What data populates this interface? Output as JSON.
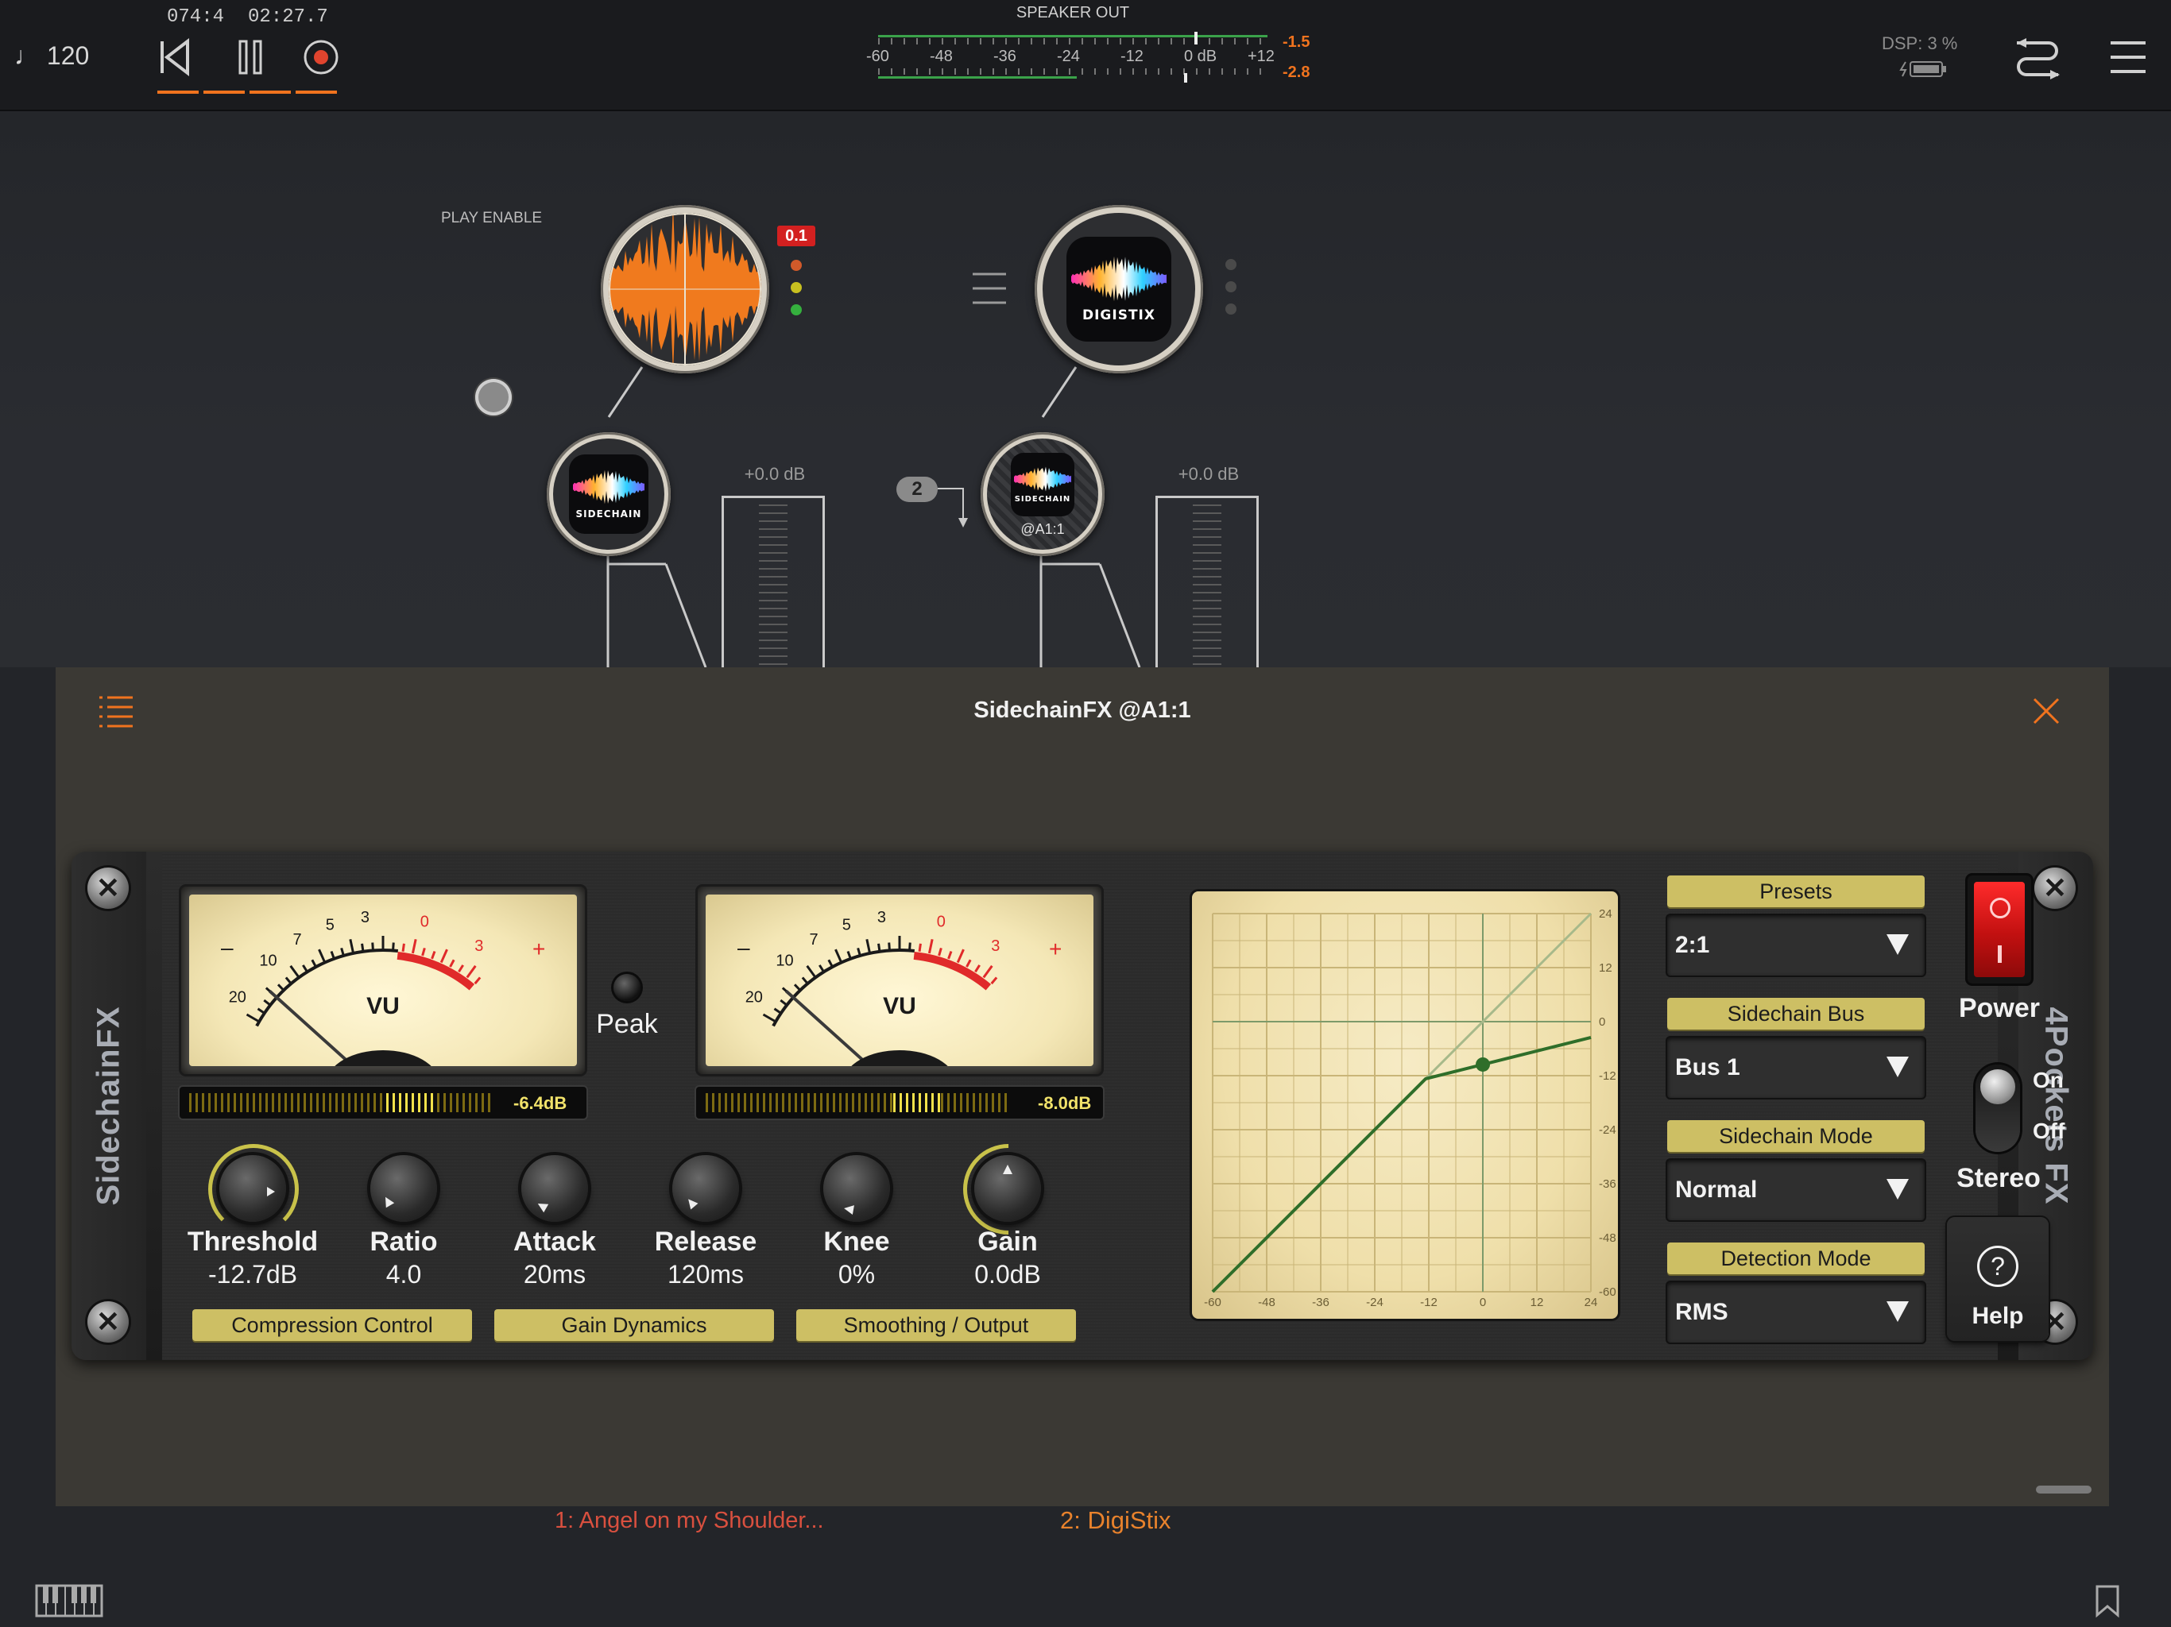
{
  "topbar": {
    "tempo": "♩ 120",
    "position": "074:4",
    "time": "02:27.7",
    "speaker_out_label": "SPEAKER OUT",
    "meter_scale": [
      "-60",
      "-48",
      "-36",
      "-24",
      "-12",
      "0 dB",
      "+12"
    ],
    "peak_left": "-1.5",
    "peak_right": "-2.8",
    "dsp_label": "DSP:  3 %",
    "accent_color": "#f0731e"
  },
  "workspace": {
    "play_enable_label": "PLAY ENABLE",
    "track1_peak": "0.1",
    "digistix_label": "DIGISTIX",
    "sidechain_label": "SIDECHAIN",
    "sidechain2_label": "SIDECHAIN",
    "sidechain2_sub": "@A1:1",
    "bus_badge": "2",
    "fader1_db": "+0.0 dB",
    "fader2_db": "+0.0 dB"
  },
  "plugin": {
    "title": "SidechainFX @A1:1",
    "left_ear": "SidechainFX",
    "right_ear": "4Pockets FX",
    "vu_label": "VU",
    "vu_scale": [
      "20",
      "10",
      "7",
      "5",
      "3",
      "0",
      "3"
    ],
    "vu_minus": "–",
    "vu_plus": "+",
    "peak_label": "Peak",
    "meter1_value": "-6.4dB",
    "meter2_value": "-8.0dB",
    "meter1_level": 0.81,
    "meter2_level": 0.78,
    "knobs": [
      {
        "name": "Threshold",
        "value": "-12.7dB"
      },
      {
        "name": "Ratio",
        "value": "4.0"
      },
      {
        "name": "Attack",
        "value": "20ms"
      },
      {
        "name": "Release",
        "value": "120ms"
      },
      {
        "name": "Knee",
        "value": "0%"
      },
      {
        "name": "Gain",
        "value": "0.0dB"
      }
    ],
    "sections": [
      "Compression Control",
      "Gain Dynamics",
      "Smoothing / Output"
    ],
    "graph": {
      "x_ticks": [
        "-60",
        "-48",
        "-36",
        "-24",
        "-12",
        "0",
        "12",
        "24"
      ],
      "y_ticks": [
        "24",
        "12",
        "0",
        "-12",
        "-24",
        "-36",
        "-48",
        "-60"
      ]
    },
    "presets_label": "Presets",
    "presets_value": "2:1",
    "bus_label": "Sidechain Bus",
    "bus_value": "Bus 1",
    "mode_label": "Sidechain Mode",
    "mode_value": "Normal",
    "detect_label": "Detection Mode",
    "detect_value": "RMS",
    "power_label": "Power",
    "on_label": "On",
    "off_label": "Off",
    "stereo_label": "Stereo",
    "help_label": "Help"
  },
  "bottom": {
    "track1": "1: Angel on my Shoulder...",
    "track2": "2: DigiStix",
    "track1_color": "#d9503f",
    "track2_color": "#e8822c"
  }
}
